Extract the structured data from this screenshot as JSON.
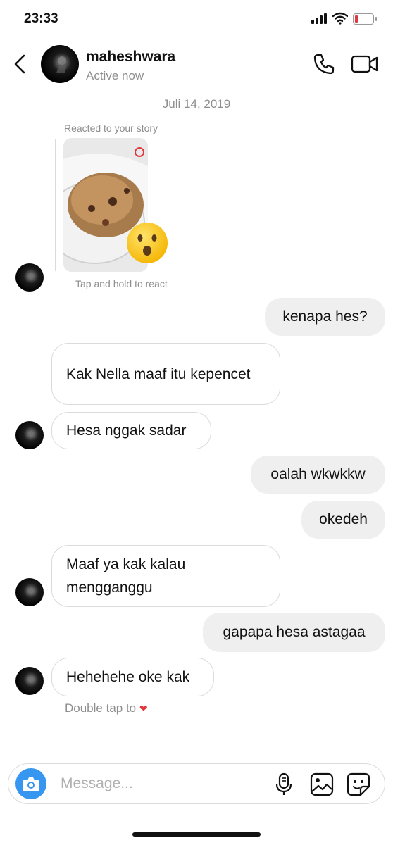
{
  "status_bar": {
    "time": "23:33"
  },
  "header": {
    "username": "maheshwara",
    "status": "Active now"
  },
  "chat": {
    "date": "Juli 14, 2019",
    "story_reply": {
      "label": "Reacted to your story",
      "hint": "Tap and hold to react"
    },
    "messages": [
      {
        "from": "me",
        "text": "kenapa hes?"
      },
      {
        "from": "them",
        "text": "Kak Nella maaf itu kepencet"
      },
      {
        "from": "them",
        "text": "Hesa nggak sadar"
      },
      {
        "from": "me",
        "text": "oalah wkwkkw"
      },
      {
        "from": "me",
        "text": "okedeh"
      },
      {
        "from": "them",
        "text": "Maaf ya kak kalau mengganggu"
      },
      {
        "from": "me",
        "text": "gapapa hesa astagaa"
      },
      {
        "from": "them",
        "text": "Hehehehe oke kak"
      }
    ],
    "double_tap_hint": "Double tap to"
  },
  "composer": {
    "placeholder": "Message..."
  },
  "icons": {
    "back": "chevron-left-icon",
    "call": "phone-icon",
    "video": "video-camera-icon",
    "camera": "camera-icon",
    "mic": "microphone-icon",
    "gallery": "image-icon",
    "sticker": "sticker-icon",
    "heart": "heart-icon",
    "reaction": "surprised-face-emoji"
  },
  "colors": {
    "accent": "#3797f0",
    "heart": "#e0383e",
    "muted": "#8e8e8e",
    "outgoing_bubble": "#efefef",
    "border": "#dbdbdb"
  }
}
